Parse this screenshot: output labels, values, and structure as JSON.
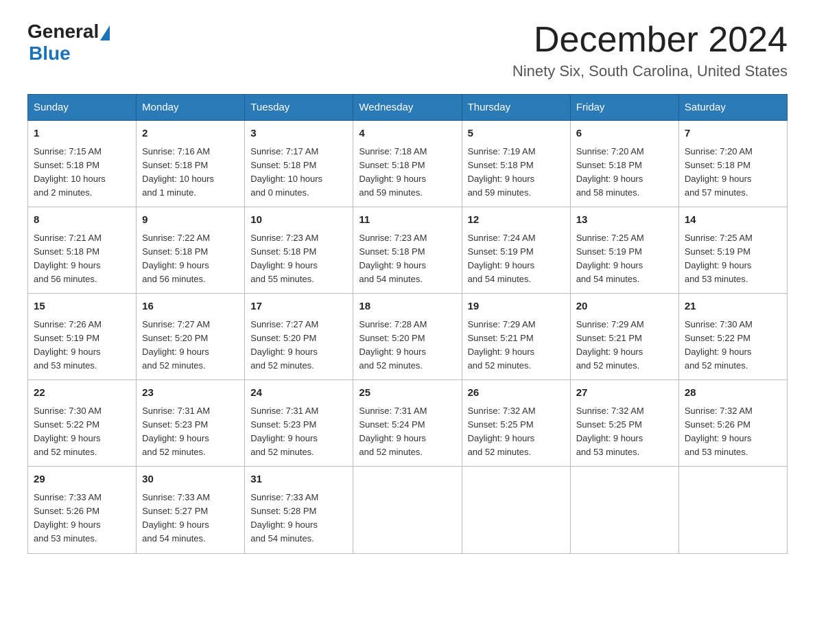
{
  "header": {
    "logo_general": "General",
    "logo_blue": "Blue",
    "month_title": "December 2024",
    "subtitle": "Ninety Six, South Carolina, United States"
  },
  "days_of_week": [
    "Sunday",
    "Monday",
    "Tuesday",
    "Wednesday",
    "Thursday",
    "Friday",
    "Saturday"
  ],
  "weeks": [
    [
      {
        "day": "1",
        "sunrise": "7:15 AM",
        "sunset": "5:18 PM",
        "daylight": "10 hours and 2 minutes."
      },
      {
        "day": "2",
        "sunrise": "7:16 AM",
        "sunset": "5:18 PM",
        "daylight": "10 hours and 1 minute."
      },
      {
        "day": "3",
        "sunrise": "7:17 AM",
        "sunset": "5:18 PM",
        "daylight": "10 hours and 0 minutes."
      },
      {
        "day": "4",
        "sunrise": "7:18 AM",
        "sunset": "5:18 PM",
        "daylight": "9 hours and 59 minutes."
      },
      {
        "day": "5",
        "sunrise": "7:19 AM",
        "sunset": "5:18 PM",
        "daylight": "9 hours and 59 minutes."
      },
      {
        "day": "6",
        "sunrise": "7:20 AM",
        "sunset": "5:18 PM",
        "daylight": "9 hours and 58 minutes."
      },
      {
        "day": "7",
        "sunrise": "7:20 AM",
        "sunset": "5:18 PM",
        "daylight": "9 hours and 57 minutes."
      }
    ],
    [
      {
        "day": "8",
        "sunrise": "7:21 AM",
        "sunset": "5:18 PM",
        "daylight": "9 hours and 56 minutes."
      },
      {
        "day": "9",
        "sunrise": "7:22 AM",
        "sunset": "5:18 PM",
        "daylight": "9 hours and 56 minutes."
      },
      {
        "day": "10",
        "sunrise": "7:23 AM",
        "sunset": "5:18 PM",
        "daylight": "9 hours and 55 minutes."
      },
      {
        "day": "11",
        "sunrise": "7:23 AM",
        "sunset": "5:18 PM",
        "daylight": "9 hours and 54 minutes."
      },
      {
        "day": "12",
        "sunrise": "7:24 AM",
        "sunset": "5:19 PM",
        "daylight": "9 hours and 54 minutes."
      },
      {
        "day": "13",
        "sunrise": "7:25 AM",
        "sunset": "5:19 PM",
        "daylight": "9 hours and 54 minutes."
      },
      {
        "day": "14",
        "sunrise": "7:25 AM",
        "sunset": "5:19 PM",
        "daylight": "9 hours and 53 minutes."
      }
    ],
    [
      {
        "day": "15",
        "sunrise": "7:26 AM",
        "sunset": "5:19 PM",
        "daylight": "9 hours and 53 minutes."
      },
      {
        "day": "16",
        "sunrise": "7:27 AM",
        "sunset": "5:20 PM",
        "daylight": "9 hours and 52 minutes."
      },
      {
        "day": "17",
        "sunrise": "7:27 AM",
        "sunset": "5:20 PM",
        "daylight": "9 hours and 52 minutes."
      },
      {
        "day": "18",
        "sunrise": "7:28 AM",
        "sunset": "5:20 PM",
        "daylight": "9 hours and 52 minutes."
      },
      {
        "day": "19",
        "sunrise": "7:29 AM",
        "sunset": "5:21 PM",
        "daylight": "9 hours and 52 minutes."
      },
      {
        "day": "20",
        "sunrise": "7:29 AM",
        "sunset": "5:21 PM",
        "daylight": "9 hours and 52 minutes."
      },
      {
        "day": "21",
        "sunrise": "7:30 AM",
        "sunset": "5:22 PM",
        "daylight": "9 hours and 52 minutes."
      }
    ],
    [
      {
        "day": "22",
        "sunrise": "7:30 AM",
        "sunset": "5:22 PM",
        "daylight": "9 hours and 52 minutes."
      },
      {
        "day": "23",
        "sunrise": "7:31 AM",
        "sunset": "5:23 PM",
        "daylight": "9 hours and 52 minutes."
      },
      {
        "day": "24",
        "sunrise": "7:31 AM",
        "sunset": "5:23 PM",
        "daylight": "9 hours and 52 minutes."
      },
      {
        "day": "25",
        "sunrise": "7:31 AM",
        "sunset": "5:24 PM",
        "daylight": "9 hours and 52 minutes."
      },
      {
        "day": "26",
        "sunrise": "7:32 AM",
        "sunset": "5:25 PM",
        "daylight": "9 hours and 52 minutes."
      },
      {
        "day": "27",
        "sunrise": "7:32 AM",
        "sunset": "5:25 PM",
        "daylight": "9 hours and 53 minutes."
      },
      {
        "day": "28",
        "sunrise": "7:32 AM",
        "sunset": "5:26 PM",
        "daylight": "9 hours and 53 minutes."
      }
    ],
    [
      {
        "day": "29",
        "sunrise": "7:33 AM",
        "sunset": "5:26 PM",
        "daylight": "9 hours and 53 minutes."
      },
      {
        "day": "30",
        "sunrise": "7:33 AM",
        "sunset": "5:27 PM",
        "daylight": "9 hours and 54 minutes."
      },
      {
        "day": "31",
        "sunrise": "7:33 AM",
        "sunset": "5:28 PM",
        "daylight": "9 hours and 54 minutes."
      },
      null,
      null,
      null,
      null
    ]
  ],
  "labels": {
    "sunrise": "Sunrise:",
    "sunset": "Sunset:",
    "daylight": "Daylight:"
  }
}
